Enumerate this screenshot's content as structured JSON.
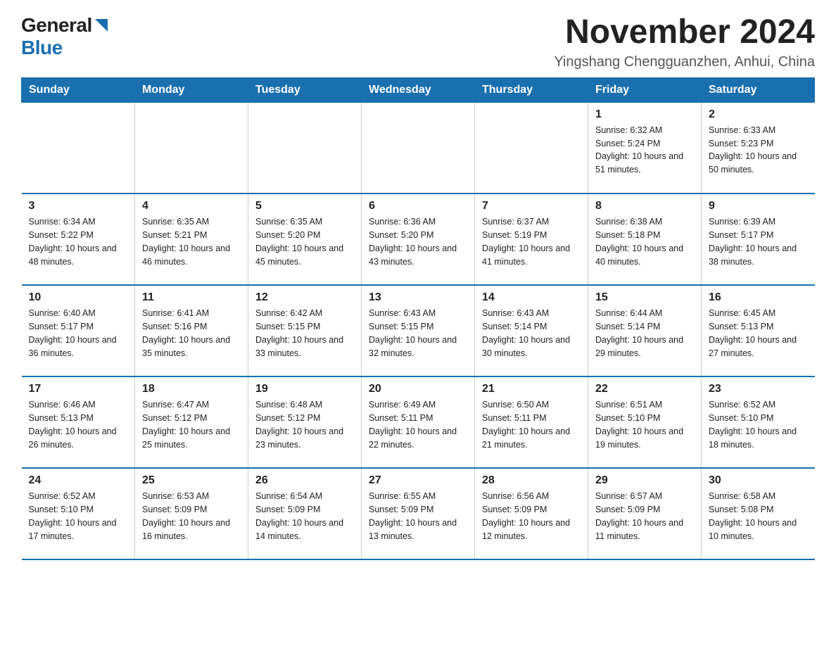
{
  "logo": {
    "general": "General",
    "blue": "Blue",
    "triangle": "▲"
  },
  "title": "November 2024",
  "subtitle": "Yingshang Chengguanzhen, Anhui, China",
  "weekdays": [
    "Sunday",
    "Monday",
    "Tuesday",
    "Wednesday",
    "Thursday",
    "Friday",
    "Saturday"
  ],
  "weeks": [
    [
      {
        "day": "",
        "info": ""
      },
      {
        "day": "",
        "info": ""
      },
      {
        "day": "",
        "info": ""
      },
      {
        "day": "",
        "info": ""
      },
      {
        "day": "",
        "info": ""
      },
      {
        "day": "1",
        "info": "Sunrise: 6:32 AM\nSunset: 5:24 PM\nDaylight: 10 hours and 51 minutes."
      },
      {
        "day": "2",
        "info": "Sunrise: 6:33 AM\nSunset: 5:23 PM\nDaylight: 10 hours and 50 minutes."
      }
    ],
    [
      {
        "day": "3",
        "info": "Sunrise: 6:34 AM\nSunset: 5:22 PM\nDaylight: 10 hours and 48 minutes."
      },
      {
        "day": "4",
        "info": "Sunrise: 6:35 AM\nSunset: 5:21 PM\nDaylight: 10 hours and 46 minutes."
      },
      {
        "day": "5",
        "info": "Sunrise: 6:35 AM\nSunset: 5:20 PM\nDaylight: 10 hours and 45 minutes."
      },
      {
        "day": "6",
        "info": "Sunrise: 6:36 AM\nSunset: 5:20 PM\nDaylight: 10 hours and 43 minutes."
      },
      {
        "day": "7",
        "info": "Sunrise: 6:37 AM\nSunset: 5:19 PM\nDaylight: 10 hours and 41 minutes."
      },
      {
        "day": "8",
        "info": "Sunrise: 6:38 AM\nSunset: 5:18 PM\nDaylight: 10 hours and 40 minutes."
      },
      {
        "day": "9",
        "info": "Sunrise: 6:39 AM\nSunset: 5:17 PM\nDaylight: 10 hours and 38 minutes."
      }
    ],
    [
      {
        "day": "10",
        "info": "Sunrise: 6:40 AM\nSunset: 5:17 PM\nDaylight: 10 hours and 36 minutes."
      },
      {
        "day": "11",
        "info": "Sunrise: 6:41 AM\nSunset: 5:16 PM\nDaylight: 10 hours and 35 minutes."
      },
      {
        "day": "12",
        "info": "Sunrise: 6:42 AM\nSunset: 5:15 PM\nDaylight: 10 hours and 33 minutes."
      },
      {
        "day": "13",
        "info": "Sunrise: 6:43 AM\nSunset: 5:15 PM\nDaylight: 10 hours and 32 minutes."
      },
      {
        "day": "14",
        "info": "Sunrise: 6:43 AM\nSunset: 5:14 PM\nDaylight: 10 hours and 30 minutes."
      },
      {
        "day": "15",
        "info": "Sunrise: 6:44 AM\nSunset: 5:14 PM\nDaylight: 10 hours and 29 minutes."
      },
      {
        "day": "16",
        "info": "Sunrise: 6:45 AM\nSunset: 5:13 PM\nDaylight: 10 hours and 27 minutes."
      }
    ],
    [
      {
        "day": "17",
        "info": "Sunrise: 6:46 AM\nSunset: 5:13 PM\nDaylight: 10 hours and 26 minutes."
      },
      {
        "day": "18",
        "info": "Sunrise: 6:47 AM\nSunset: 5:12 PM\nDaylight: 10 hours and 25 minutes."
      },
      {
        "day": "19",
        "info": "Sunrise: 6:48 AM\nSunset: 5:12 PM\nDaylight: 10 hours and 23 minutes."
      },
      {
        "day": "20",
        "info": "Sunrise: 6:49 AM\nSunset: 5:11 PM\nDaylight: 10 hours and 22 minutes."
      },
      {
        "day": "21",
        "info": "Sunrise: 6:50 AM\nSunset: 5:11 PM\nDaylight: 10 hours and 21 minutes."
      },
      {
        "day": "22",
        "info": "Sunrise: 6:51 AM\nSunset: 5:10 PM\nDaylight: 10 hours and 19 minutes."
      },
      {
        "day": "23",
        "info": "Sunrise: 6:52 AM\nSunset: 5:10 PM\nDaylight: 10 hours and 18 minutes."
      }
    ],
    [
      {
        "day": "24",
        "info": "Sunrise: 6:52 AM\nSunset: 5:10 PM\nDaylight: 10 hours and 17 minutes."
      },
      {
        "day": "25",
        "info": "Sunrise: 6:53 AM\nSunset: 5:09 PM\nDaylight: 10 hours and 16 minutes."
      },
      {
        "day": "26",
        "info": "Sunrise: 6:54 AM\nSunset: 5:09 PM\nDaylight: 10 hours and 14 minutes."
      },
      {
        "day": "27",
        "info": "Sunrise: 6:55 AM\nSunset: 5:09 PM\nDaylight: 10 hours and 13 minutes."
      },
      {
        "day": "28",
        "info": "Sunrise: 6:56 AM\nSunset: 5:09 PM\nDaylight: 10 hours and 12 minutes."
      },
      {
        "day": "29",
        "info": "Sunrise: 6:57 AM\nSunset: 5:09 PM\nDaylight: 10 hours and 11 minutes."
      },
      {
        "day": "30",
        "info": "Sunrise: 6:58 AM\nSunset: 5:08 PM\nDaylight: 10 hours and 10 minutes."
      }
    ]
  ],
  "colors": {
    "header_bg": "#1a6faf",
    "header_text": "#ffffff",
    "border": "#1a6faf"
  }
}
